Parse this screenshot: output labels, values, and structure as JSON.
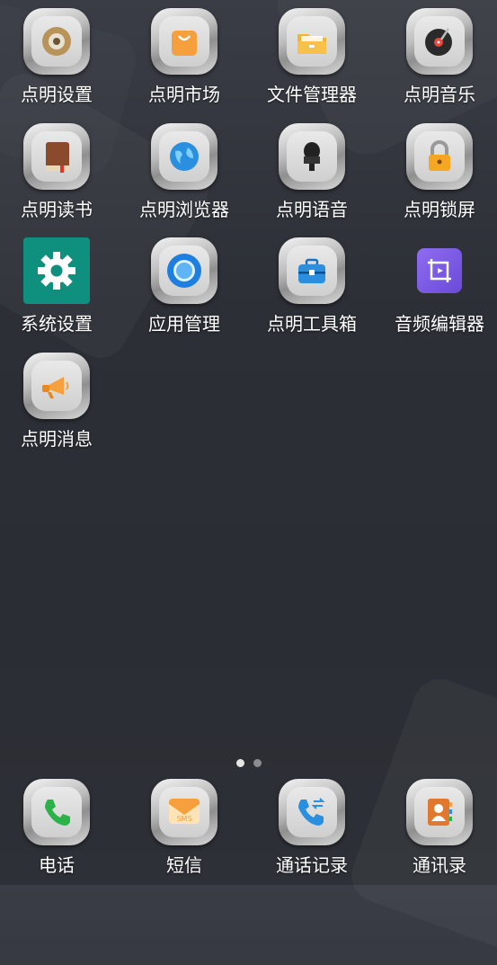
{
  "apps": [
    {
      "label": "点明设置",
      "icon": "settings-gear-icon"
    },
    {
      "label": "点明市场",
      "icon": "shopping-bag-icon"
    },
    {
      "label": "文件管理器",
      "icon": "folder-icon"
    },
    {
      "label": "点明音乐",
      "icon": "music-disc-icon"
    },
    {
      "label": "点明读书",
      "icon": "book-icon"
    },
    {
      "label": "点明浏览器",
      "icon": "globe-icon"
    },
    {
      "label": "点明语音",
      "icon": "microphone-icon"
    },
    {
      "label": "点明锁屏",
      "icon": "lock-icon"
    },
    {
      "label": "系统设置",
      "icon": "gear-icon"
    },
    {
      "label": "应用管理",
      "icon": "app-manager-icon"
    },
    {
      "label": "点明工具箱",
      "icon": "toolbox-icon"
    },
    {
      "label": "音频编辑器",
      "icon": "audio-crop-icon"
    },
    {
      "label": "点明消息",
      "icon": "megaphone-icon"
    }
  ],
  "page_indicator": {
    "pages": 2,
    "current": 1
  },
  "dock": [
    {
      "label": "电话",
      "icon": "phone-icon"
    },
    {
      "label": "短信",
      "icon": "sms-icon"
    },
    {
      "label": "通话记录",
      "icon": "call-log-icon"
    },
    {
      "label": "通讯录",
      "icon": "contacts-icon"
    }
  ],
  "sms_badge_text": "SMS",
  "colors": {
    "teal": "#0f8f7e",
    "purple": "#7a5ce0",
    "orange": "#f5a03c",
    "blue": "#2b8fe0",
    "green": "#2bb34a"
  }
}
